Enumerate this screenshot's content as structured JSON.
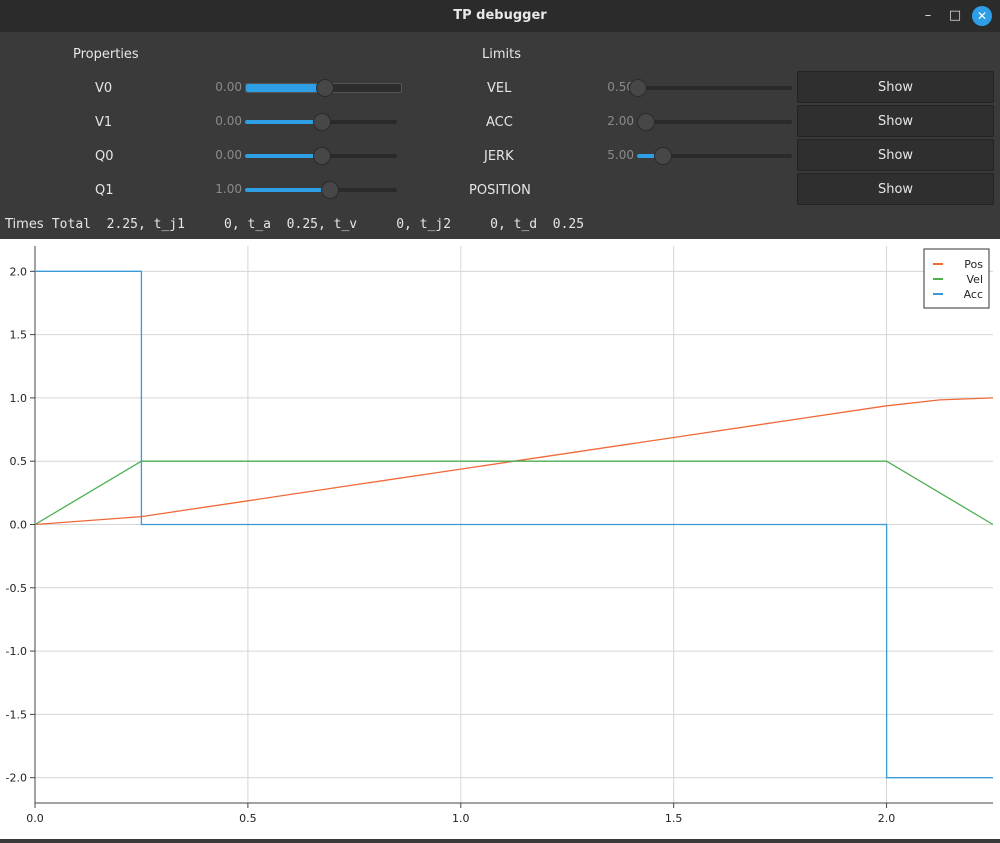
{
  "window": {
    "title": "TP debugger",
    "minimize_icon": "minimize-icon",
    "maximize_icon": "maximize-icon",
    "close_icon": "close-icon"
  },
  "properties": {
    "header": "Properties",
    "rows": [
      {
        "name": "V0",
        "value": "0.00",
        "fraction": 0.5
      },
      {
        "name": "V1",
        "value": "0.00",
        "fraction": 0.5
      },
      {
        "name": "Q0",
        "value": "0.00",
        "fraction": 0.5
      },
      {
        "name": "Q1",
        "value": "1.00",
        "fraction": 0.55
      }
    ]
  },
  "limits": {
    "header": "Limits",
    "rows": [
      {
        "name": "VEL",
        "value": "0.50",
        "fraction": 0.0,
        "button": "Show"
      },
      {
        "name": "ACC",
        "value": "2.00",
        "fraction": 0.05,
        "button": "Show"
      },
      {
        "name": "JERK",
        "value": "5.00",
        "fraction": 0.16,
        "button": "Show"
      },
      {
        "name": "POSITION",
        "value": "",
        "button": "Show"
      }
    ]
  },
  "times": {
    "label": "Times",
    "text": "Total  2.25, t_j1     0, t_a  0.25, t_v     0, t_j2     0, t_d  0.25"
  },
  "chart_data": {
    "type": "line",
    "title": "",
    "xlabel": "",
    "ylabel": "",
    "xlim": [
      0.0,
      2.25
    ],
    "ylim": [
      -2.2,
      2.2
    ],
    "x_ticks": [
      "0.0",
      "0.5",
      "1.0",
      "1.5",
      "2.0"
    ],
    "y_ticks": [
      "2.0",
      "1.5",
      "1.0",
      "0.5",
      "0.0",
      "-0.5",
      "-1.0",
      "-1.5",
      "-2.0"
    ],
    "grid": true,
    "legend_position": "top-right",
    "series": [
      {
        "name": "Pos",
        "color": "#f0693a",
        "x": [
          0,
          0.25,
          0.5,
          0.75,
          1.0,
          1.25,
          1.5,
          1.75,
          2.0,
          2.125,
          2.25
        ],
        "y": [
          0,
          0.0625,
          0.1875,
          0.3125,
          0.4375,
          0.5625,
          0.6875,
          0.8125,
          0.9375,
          0.9844,
          1.0
        ]
      },
      {
        "name": "Vel",
        "color": "#4caf50",
        "x": [
          0,
          0.25,
          2.0,
          2.25
        ],
        "y": [
          0,
          0.5,
          0.5,
          0
        ]
      },
      {
        "name": "Acc",
        "color": "#3a9ad9",
        "x": [
          0,
          0.25,
          0.25,
          2.0,
          2.0,
          2.25
        ],
        "y": [
          2.0,
          2.0,
          0,
          0,
          -2.0,
          -2.0
        ]
      }
    ]
  }
}
